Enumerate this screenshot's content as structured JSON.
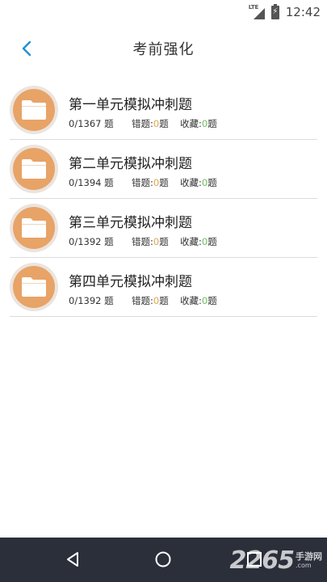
{
  "status_bar": {
    "network": "LTE",
    "time": "12:42"
  },
  "header": {
    "title": "考前强化"
  },
  "items": [
    {
      "title": "第一单元模拟冲刺题",
      "progress": "0/1367 题",
      "wrong_label": "错题:",
      "wrong_count": "0",
      "wrong_unit": "题",
      "fav_label": "收藏:",
      "fav_count": "0",
      "fav_unit": "题"
    },
    {
      "title": "第二单元模拟冲刺题",
      "progress": "0/1394 题",
      "wrong_label": "错题:",
      "wrong_count": "0",
      "wrong_unit": "题",
      "fav_label": "收藏:",
      "fav_count": "0",
      "fav_unit": "题"
    },
    {
      "title": "第三单元模拟冲刺题",
      "progress": "0/1392 题",
      "wrong_label": "错题:",
      "wrong_count": "0",
      "wrong_unit": "题",
      "fav_label": "收藏:",
      "fav_count": "0",
      "fav_unit": "题"
    },
    {
      "title": "第四单元模拟冲刺题",
      "progress": "0/1392 题",
      "wrong_label": "错题:",
      "wrong_count": "0",
      "wrong_unit": "题",
      "fav_label": "收藏:",
      "fav_count": "0",
      "fav_unit": "题"
    }
  ],
  "watermark": {
    "big": "2265",
    "small_top": "手游网",
    "small_bottom": ".com"
  },
  "colors": {
    "accent": "#1e90d8",
    "folder": "#e8a367",
    "wrong_count": "#e0a450",
    "fav_count": "#6bbf5a",
    "nav_bar": "#2a2f3a"
  },
  "icons": {
    "back": "chevron-left-icon",
    "folder": "folder-icon",
    "nav_back": "triangle-back-icon",
    "nav_home": "circle-home-icon",
    "nav_recents": "square-recents-icon"
  }
}
